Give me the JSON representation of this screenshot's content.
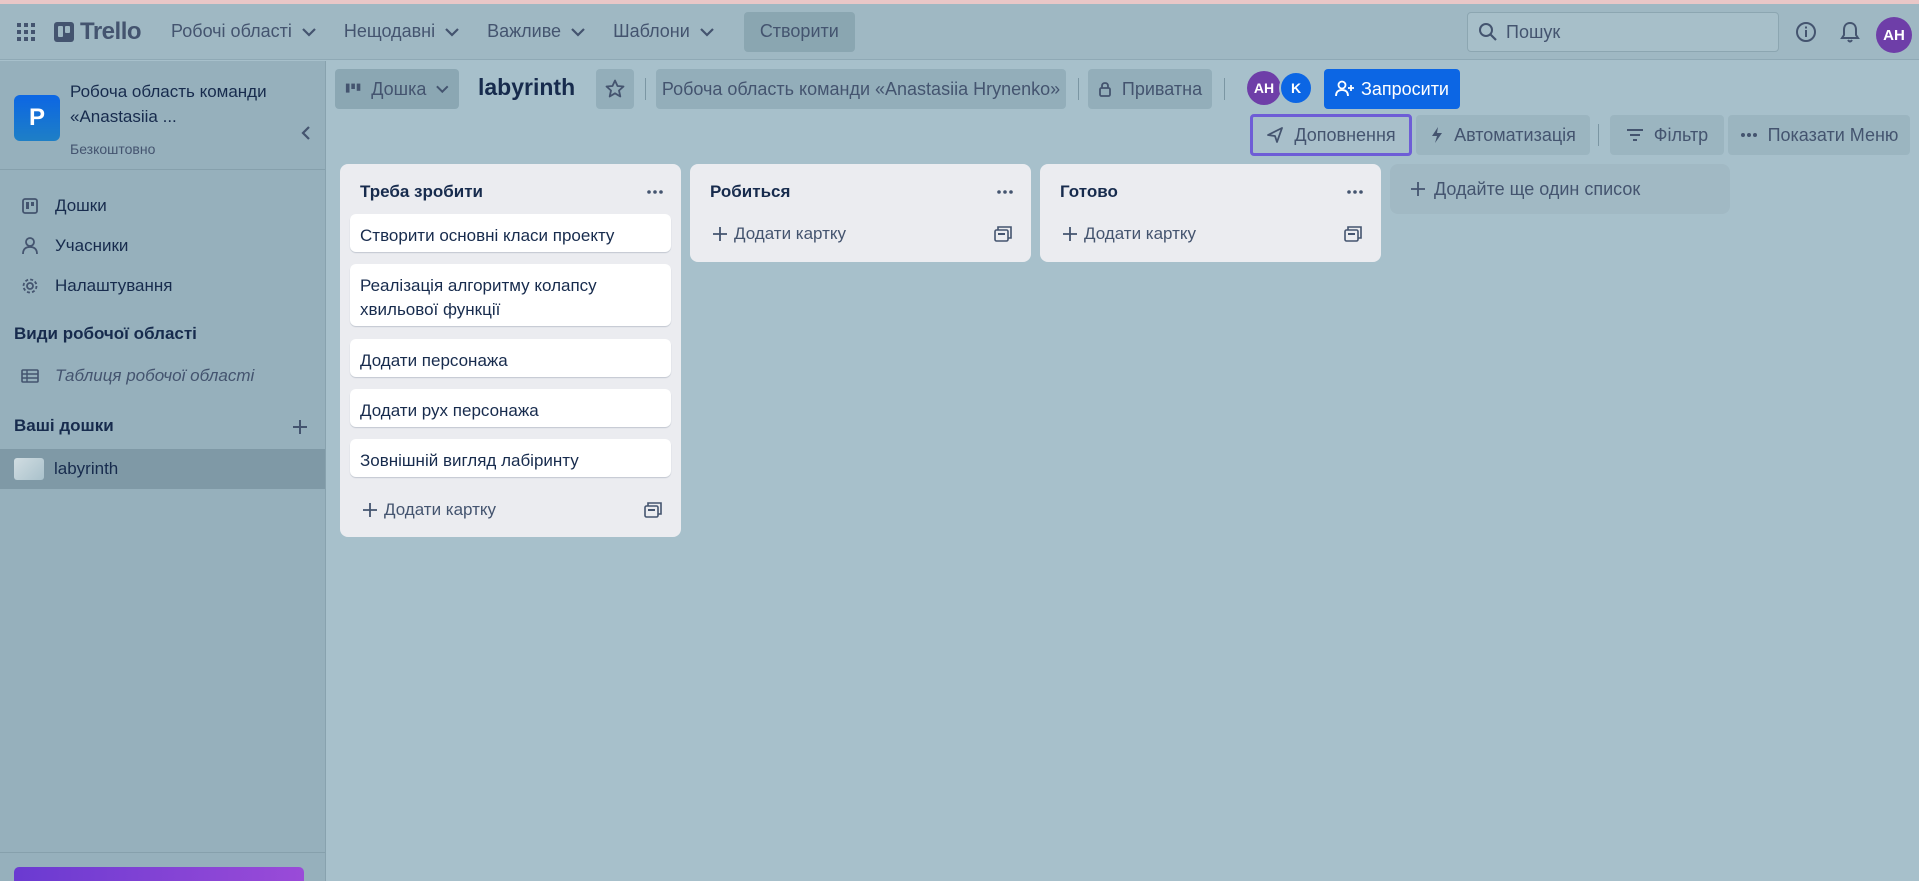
{
  "topbar": {
    "brand": "Trello",
    "menus": [
      "Робочі області",
      "Нещодавні",
      "Важливе",
      "Шаблони"
    ],
    "create_label": "Створити",
    "search_placeholder": "Пошук",
    "user_initials": "AH"
  },
  "sidebar": {
    "workspace_letter": "P",
    "workspace_name": "Робоча область команди «Anastasiia ...",
    "workspace_plan": "Безкоштовно",
    "nav": [
      "Дошки",
      "Учасники",
      "Налаштування"
    ],
    "views_heading": "Види робочої області",
    "views_item": "Таблиця робочої області",
    "boards_heading": "Ваші дошки",
    "boards": [
      "labyrinth"
    ]
  },
  "board_header": {
    "view_label": "Дошка",
    "title": "labyrinth",
    "workspace_label": "Робоча область команди «Anastasiia Hrynenko»",
    "visibility_label": "Приватна",
    "members": [
      {
        "initials": "AH",
        "color": "#6e3ea8"
      },
      {
        "initials": "K",
        "color": "#0c66e4"
      }
    ],
    "invite_label": "Запросити",
    "powerups_label": "Доповнення",
    "automation_label": "Автоматизація",
    "filter_label": "Фільтр",
    "menu_label": "Показати Меню"
  },
  "lists": [
    {
      "title": "Треба зробити",
      "cards": [
        "Створити основні класи проекту",
        "Реалізація алгоритму колапсу хвильової функції",
        "Додати персонажа",
        "Додати рух персонажа",
        "Зовнішній вигляд лабіринту"
      ],
      "add_card_label": "Додати картку"
    },
    {
      "title": "Робиться",
      "cards": [],
      "add_card_label": "Додати картку"
    },
    {
      "title": "Готово",
      "cards": [],
      "add_card_label": "Додати картку"
    }
  ],
  "add_list_label": "Додайте ще один список"
}
